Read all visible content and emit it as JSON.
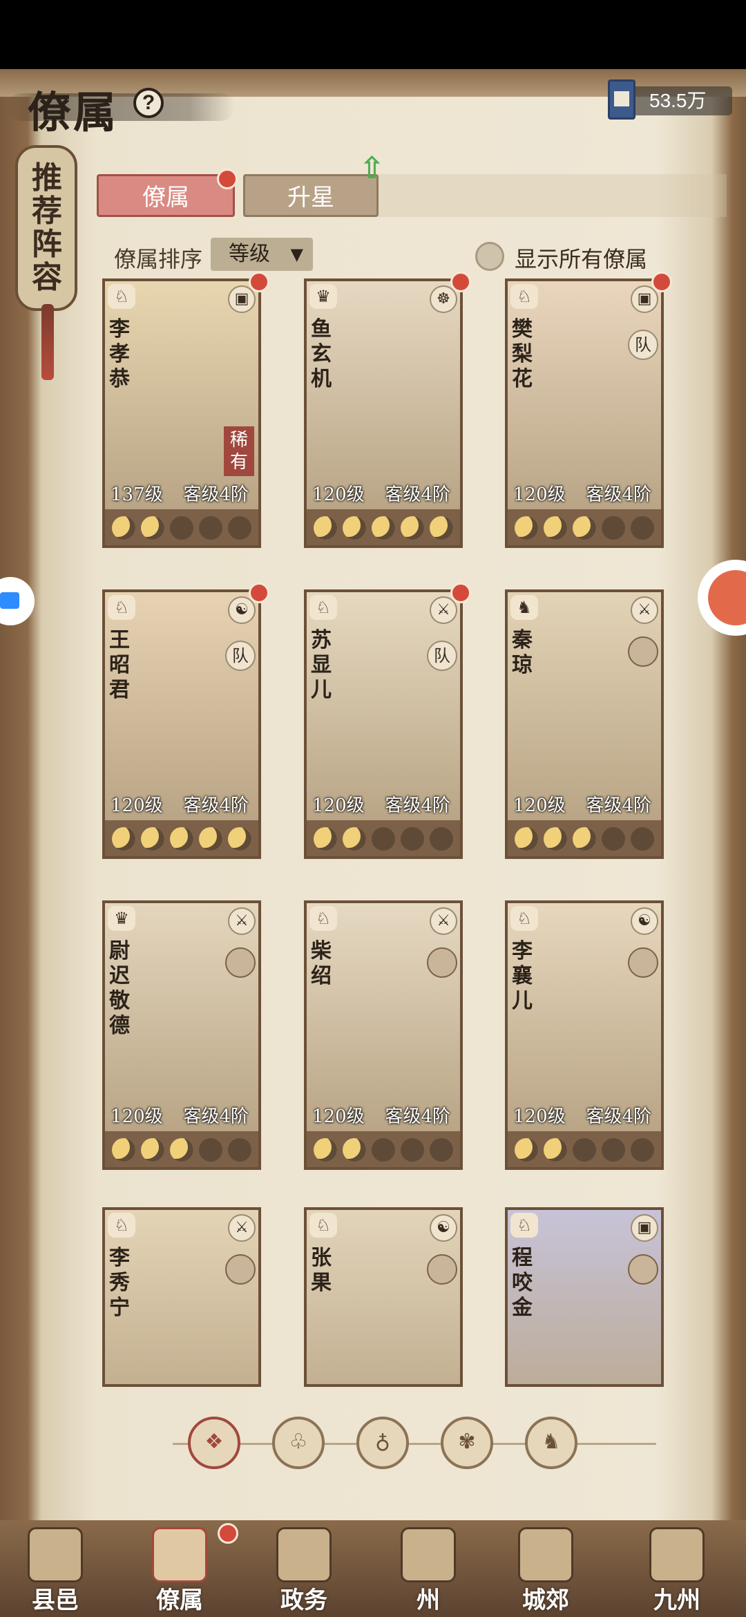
{
  "header": {
    "title": "僚属",
    "help_icon": "question-icon",
    "currency_value": "53.5万",
    "currency_icon": "book-icon"
  },
  "side_banner": {
    "label": "推荐阵容"
  },
  "tabs": [
    {
      "label": "僚属",
      "active": true
    },
    {
      "label": "升星",
      "active": false
    }
  ],
  "sort": {
    "label": "僚属排序",
    "selected": "等级"
  },
  "show_all": {
    "label": "显示所有僚属",
    "checked": false
  },
  "cards": [
    {
      "name": "李孝恭",
      "level": "137级",
      "rank": "客级4阶",
      "moons": 2,
      "rare": "稀有",
      "team": "",
      "color": "#e8d6b0",
      "dot": true
    },
    {
      "name": "鱼玄机",
      "level": "120级",
      "rank": "客级4阶",
      "moons": 5,
      "rare": "",
      "team": "",
      "color": "#e6d8c1",
      "dot": true
    },
    {
      "name": "樊梨花",
      "level": "120级",
      "rank": "客级4阶",
      "moons": 3,
      "rare": "",
      "team": "队",
      "color": "#e9d6bd",
      "dot": true
    },
    {
      "name": "王昭君",
      "level": "120级",
      "rank": "客级4阶",
      "moons": 5,
      "rare": "",
      "team": "队",
      "color": "#e7d3b3",
      "dot": true
    },
    {
      "name": "苏显儿",
      "level": "120级",
      "rank": "客级4阶",
      "moons": 2,
      "rare": "",
      "team": "队",
      "color": "#e6d9c0",
      "dot": true
    },
    {
      "name": "秦琼",
      "level": "120级",
      "rank": "客级4阶",
      "moons": 3,
      "rare": "",
      "team": "",
      "color": "#e3d3b6",
      "dot": false
    },
    {
      "name": "尉迟敬德",
      "level": "120级",
      "rank": "客级4阶",
      "moons": 3,
      "rare": "",
      "team": "",
      "color": "#e4d6bd",
      "dot": false
    },
    {
      "name": "柴绍",
      "level": "120级",
      "rank": "客级4阶",
      "moons": 2,
      "rare": "",
      "team": "",
      "color": "#e6d9c2",
      "dot": false
    },
    {
      "name": "李襄儿",
      "level": "120级",
      "rank": "客级4阶",
      "moons": 2,
      "rare": "",
      "team": "",
      "color": "#e7d7bd",
      "dot": false
    },
    {
      "name": "李秀宁",
      "level": "",
      "rank": "",
      "moons": 0,
      "rare": "",
      "team": "",
      "color": "#e4d4b6",
      "dot": false
    },
    {
      "name": "张果",
      "level": "",
      "rank": "",
      "moons": 0,
      "rare": "",
      "team": "",
      "color": "#e2d4ba",
      "dot": false
    },
    {
      "name": "程咬金",
      "level": "",
      "rank": "",
      "moons": 0,
      "rare": "",
      "team": "",
      "color": "#c7c3d8",
      "dot": false
    }
  ],
  "filters": [
    "all-icon",
    "bell-icon",
    "gourd-icon",
    "fan-icon",
    "horse-icon"
  ],
  "nav": [
    {
      "label": "县邑",
      "icon": "town-icon",
      "active": false
    },
    {
      "label": "僚属",
      "icon": "scroll-icon",
      "active": true
    },
    {
      "label": "政务",
      "icon": "documents-icon",
      "active": false
    },
    {
      "label": "州",
      "icon": "mountain-icon",
      "active": false
    },
    {
      "label": "城郊",
      "icon": "gate-icon",
      "active": false
    },
    {
      "label": "九州",
      "icon": "map-icon",
      "active": false
    }
  ],
  "colors": {
    "accent_red": "#d44a3a",
    "frame_brown": "#6b5038",
    "paper": "#efe7d5"
  }
}
